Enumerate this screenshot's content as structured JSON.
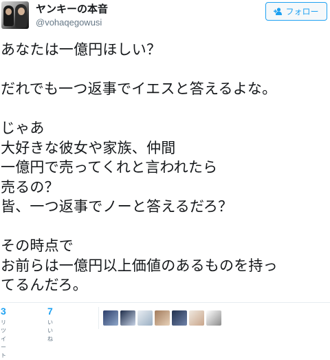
{
  "user": {
    "display_name": "ヤンキーの本音",
    "handle": "@vohaqegowusi"
  },
  "follow_button": {
    "icon": "add-user-icon",
    "label": "フォロー",
    "color": "#1da1f2"
  },
  "tweet": {
    "lines": [
      "あなたは一億円ほしい？",
      "",
      "だれでも一つ返事でイエスと答えるよな。",
      "",
      "じゃあ",
      "大好きな彼女や家族、仲間",
      "一億円で売ってくれと言われたら",
      "売るの？",
      "皆、一つ返事でノーと答えるだろ？",
      "",
      "その時点で",
      "お前らは一億円以上価値のあるものを持っ",
      "てるんだろ。"
    ]
  },
  "stats": {
    "retweets": {
      "count": "3",
      "label": "リツイート"
    },
    "likes": {
      "count": "7",
      "label": "いいね"
    }
  },
  "likers": [
    {
      "name": "liker-avatar-1",
      "colors": [
        "#2c3e6b",
        "#8fa7c9"
      ]
    },
    {
      "name": "liker-avatar-2",
      "colors": [
        "#1f2d4a",
        "#c7d3e6"
      ]
    },
    {
      "name": "liker-avatar-3",
      "colors": [
        "#e9edf2",
        "#9bb0c4"
      ]
    },
    {
      "name": "liker-avatar-4",
      "colors": [
        "#a27b5c",
        "#e8d2b9"
      ]
    },
    {
      "name": "liker-avatar-5",
      "colors": [
        "#22324f",
        "#6f82a8"
      ]
    },
    {
      "name": "liker-avatar-6",
      "colors": [
        "#efe8df",
        "#c9a58a"
      ]
    },
    {
      "name": "liker-avatar-7",
      "colors": [
        "#ffffff",
        "#8c8c8c"
      ]
    }
  ]
}
